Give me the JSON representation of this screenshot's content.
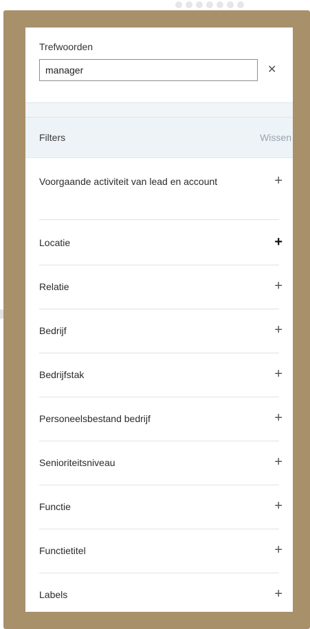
{
  "keywords": {
    "label": "Trefwoorden",
    "value": "manager",
    "clear_icon": "close-icon"
  },
  "filters": {
    "title": "Filters",
    "clear_label": "Wissen",
    "items": [
      {
        "label": "Voorgaande activiteit van lead en account",
        "icon": "plus-icon"
      },
      {
        "label": "Locatie",
        "icon": "plus-icon"
      },
      {
        "label": "Relatie",
        "icon": "plus-icon"
      },
      {
        "label": "Bedrijf",
        "icon": "plus-icon"
      },
      {
        "label": "Bedrijfstak",
        "icon": "plus-icon"
      },
      {
        "label": "Personeelsbestand bedrijf",
        "icon": "plus-icon"
      },
      {
        "label": "Senioriteitsniveau",
        "icon": "plus-icon"
      },
      {
        "label": "Functie",
        "icon": "plus-icon"
      },
      {
        "label": "Functietitel",
        "icon": "plus-icon"
      },
      {
        "label": "Labels",
        "icon": "plus-icon"
      }
    ]
  },
  "colors": {
    "frame": "#a8906a",
    "filters_header_bg": "#eef3f8",
    "clear_link": "#9aa3ad"
  }
}
